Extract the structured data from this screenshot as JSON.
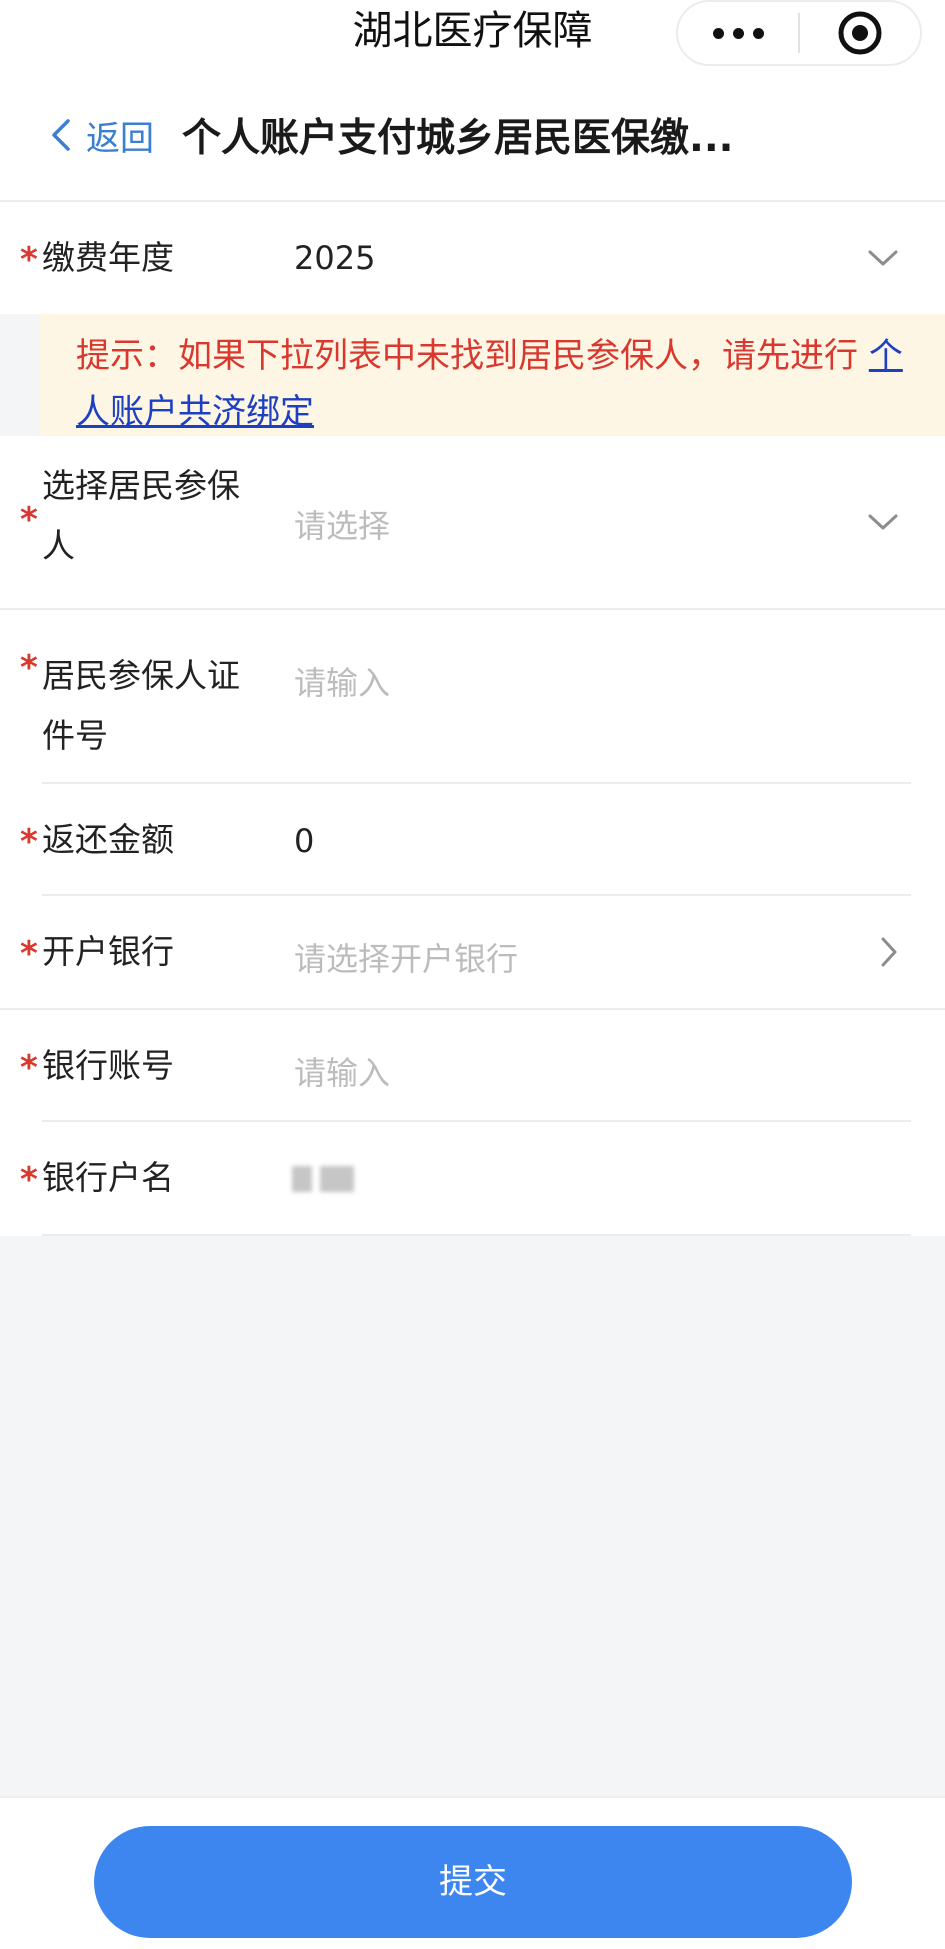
{
  "app": {
    "title": "湖北医疗保障",
    "more_icon": "more-dots-icon",
    "close_icon": "target-close-icon"
  },
  "nav": {
    "back_label": "返回",
    "page_title": "个人账户支付城乡居民医保缴..."
  },
  "form": {
    "required_mark": "*",
    "year": {
      "label": "缴费年度",
      "value": "2025"
    },
    "notice": {
      "text": "提示：如果下拉列表中未找到居民参保人，请先进行",
      "link": "个人账户共济绑定"
    },
    "insured_person": {
      "label_line1": "选择居民参保",
      "label_line2": "人",
      "placeholder": "请选择"
    },
    "id_number": {
      "label_line1": "居民参保人证",
      "label_line2": "件号",
      "placeholder": "请输入"
    },
    "refund_amount": {
      "label": "返还金额",
      "value": "0"
    },
    "bank": {
      "label": "开户银行",
      "placeholder": "请选择开户银行"
    },
    "account_no": {
      "label": "银行账号",
      "placeholder": "请输入"
    },
    "account_name": {
      "label": "银行户名"
    }
  },
  "submit": {
    "label": "提交"
  },
  "colors": {
    "required": "#d9382f",
    "link": "#1d3fc2",
    "back": "#3b7fd4",
    "primary_button": "#3d86f0",
    "notice_bg": "#fdf6e4"
  }
}
